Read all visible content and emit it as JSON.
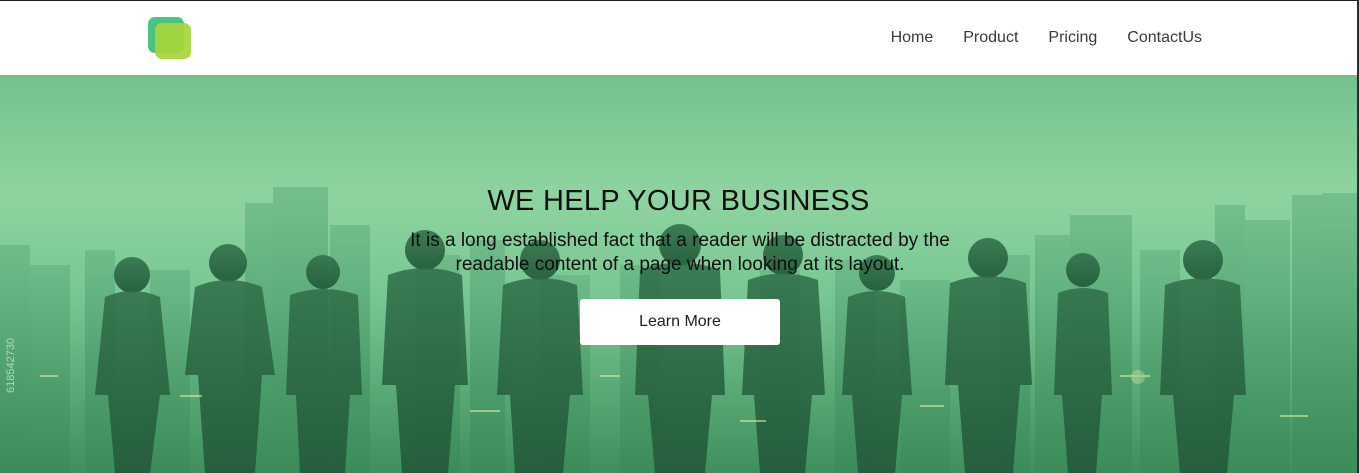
{
  "header": {
    "logo_icon": "overlapping-squares-logo",
    "nav": [
      {
        "label": "Home"
      },
      {
        "label": "Product"
      },
      {
        "label": "Pricing"
      },
      {
        "label": "ContactUs"
      }
    ]
  },
  "hero": {
    "title": "WE HELP YOUR BUSINESS",
    "subtitle": "It is a long established fact that a reader will be distracted by the readable content of a page when looking at its layout.",
    "button_label": "Learn More",
    "watermark_id": "618542730"
  },
  "colors": {
    "logo_back": "#3fc07a",
    "logo_front": "#a6d63a",
    "hero_tint": "#7cc896",
    "silhouette": "#2f6e48"
  }
}
